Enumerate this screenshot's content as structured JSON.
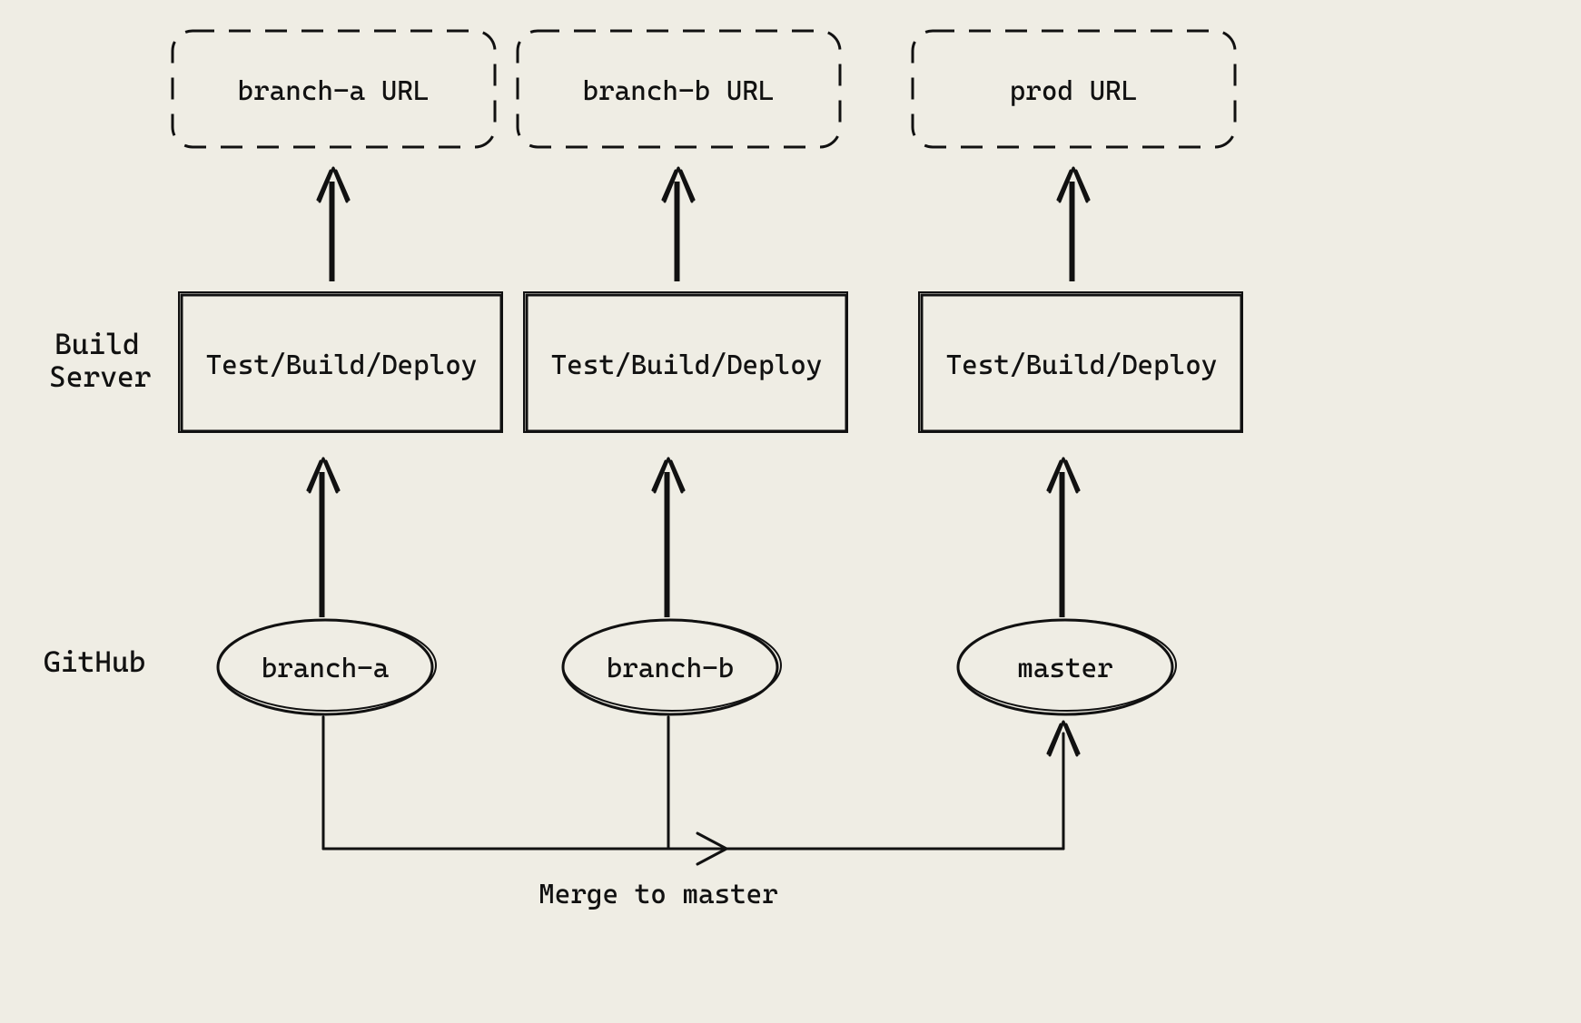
{
  "rows": {
    "build_server": "Build\nServer",
    "github": "GitHub"
  },
  "merge_label": "Merge to master",
  "columns": [
    {
      "url": "branch-a URL",
      "build": "Test/Build/Deploy",
      "branch": "branch-a"
    },
    {
      "url": "branch-b URL",
      "build": "Test/Build/Deploy",
      "branch": "branch-b"
    },
    {
      "url": "prod URL",
      "build": "Test/Build/Deploy",
      "branch": "master"
    }
  ]
}
